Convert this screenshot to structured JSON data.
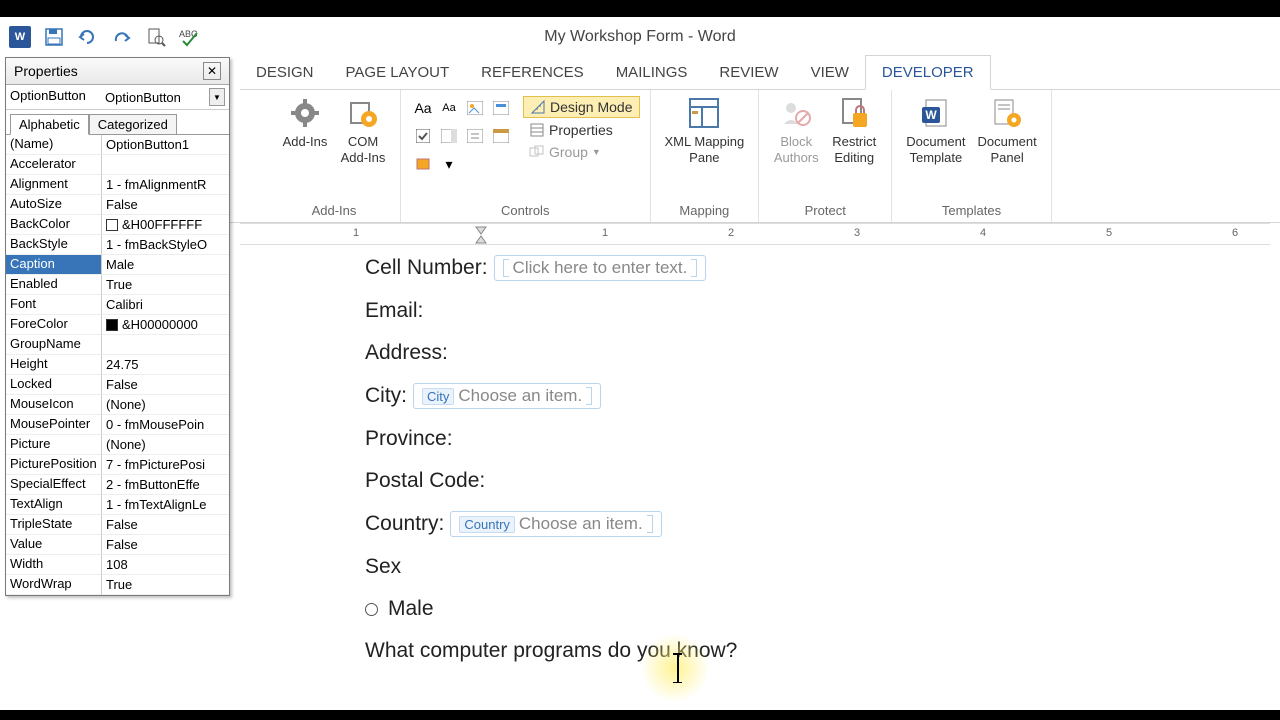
{
  "window_title": "My Workshop Form - Word",
  "properties_panel": {
    "title": "Properties",
    "object_name": "OptionButton",
    "object_type": "OptionButton",
    "tabs": {
      "alphabetic": "Alphabetic",
      "categorized": "Categorized"
    },
    "rows": [
      {
        "k": "(Name)",
        "v": "OptionButton1"
      },
      {
        "k": "Accelerator",
        "v": ""
      },
      {
        "k": "Alignment",
        "v": "1 - fmAlignmentR"
      },
      {
        "k": "AutoSize",
        "v": "False"
      },
      {
        "k": "BackColor",
        "v": "&H00FFFFFF",
        "swatch": "#ffffff"
      },
      {
        "k": "BackStyle",
        "v": "1 - fmBackStyleO"
      },
      {
        "k": "Caption",
        "v": "Male",
        "selected": true
      },
      {
        "k": "Enabled",
        "v": "True"
      },
      {
        "k": "Font",
        "v": "Calibri"
      },
      {
        "k": "ForeColor",
        "v": "&H00000000",
        "swatch": "#000000"
      },
      {
        "k": "GroupName",
        "v": ""
      },
      {
        "k": "Height",
        "v": "24.75"
      },
      {
        "k": "Locked",
        "v": "False"
      },
      {
        "k": "MouseIcon",
        "v": "(None)"
      },
      {
        "k": "MousePointer",
        "v": "0 - fmMousePoin"
      },
      {
        "k": "Picture",
        "v": "(None)"
      },
      {
        "k": "PicturePosition",
        "v": "7 - fmPicturePosi"
      },
      {
        "k": "SpecialEffect",
        "v": "2 - fmButtonEffe"
      },
      {
        "k": "TextAlign",
        "v": "1 - fmTextAlignLe"
      },
      {
        "k": "TripleState",
        "v": "False"
      },
      {
        "k": "Value",
        "v": "False"
      },
      {
        "k": "Width",
        "v": "108"
      },
      {
        "k": "WordWrap",
        "v": "True"
      }
    ]
  },
  "ribbon_tabs": [
    "DESIGN",
    "PAGE LAYOUT",
    "REFERENCES",
    "MAILINGS",
    "REVIEW",
    "VIEW",
    "DEVELOPER"
  ],
  "ribbon_active": "DEVELOPER",
  "ribbon_groups": {
    "addins": {
      "label": "Add-Ins",
      "addins": "Add-Ins",
      "com": "COM\nAdd-Ins"
    },
    "controls": {
      "label": "Controls",
      "design_mode": "Design Mode",
      "properties": "Properties",
      "group": "Group"
    },
    "mapping": {
      "label": "Mapping",
      "xml": "XML Mapping\nPane"
    },
    "protect": {
      "label": "Protect",
      "block": "Block\nAuthors",
      "restrict": "Restrict\nEditing"
    },
    "templates": {
      "label": "Templates",
      "doctemp": "Document\nTemplate",
      "docpanel": "Document\nPanel"
    }
  },
  "ruler_marks": [
    "1",
    "1",
    "2",
    "3",
    "4",
    "5",
    "6"
  ],
  "form": {
    "cell_number": {
      "label": "Cell Number:",
      "placeholder": "Click here to enter text."
    },
    "email": {
      "label": "Email:"
    },
    "address": {
      "label": "Address:"
    },
    "city": {
      "label": "City:",
      "tag": "City",
      "placeholder": "Choose an item."
    },
    "province": {
      "label": "Province:"
    },
    "postal": {
      "label": "Postal Code:"
    },
    "country": {
      "label": "Country:",
      "tag": "Country",
      "placeholder": "Choose an item."
    },
    "sex": {
      "label": "Sex",
      "male": "Male"
    },
    "question": "What computer programs do you know?"
  }
}
